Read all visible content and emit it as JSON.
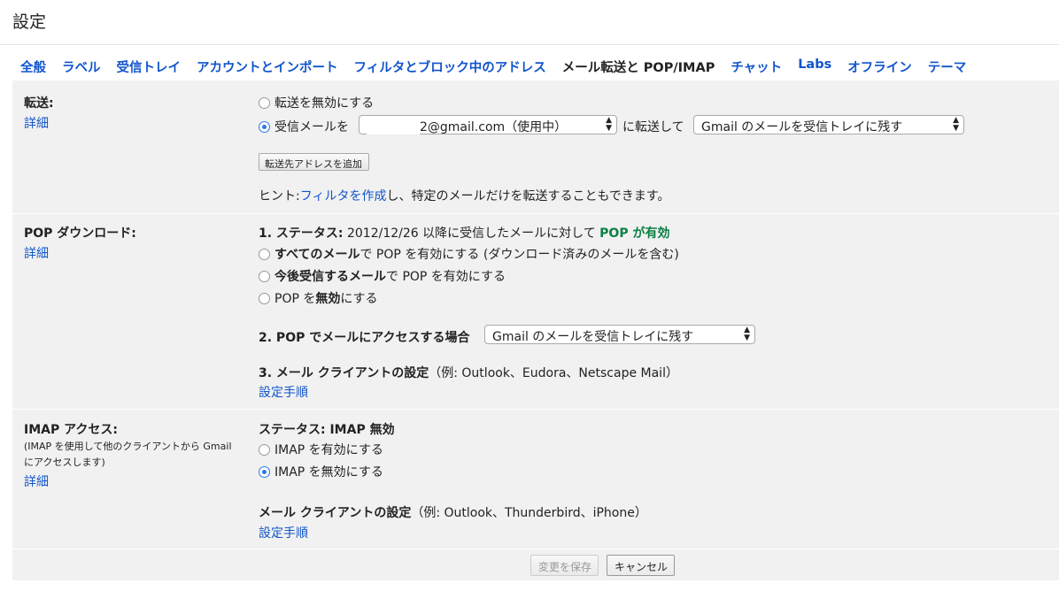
{
  "page": {
    "title": "設定"
  },
  "tabs": [
    {
      "label": "全般"
    },
    {
      "label": "ラベル"
    },
    {
      "label": "受信トレイ"
    },
    {
      "label": "アカウントとインポート"
    },
    {
      "label": "フィルタとブロック中のアドレス"
    },
    {
      "label": "メール転送と POP/IMAP",
      "active": true
    },
    {
      "label": "チャット"
    },
    {
      "label": "Labs"
    },
    {
      "label": "オフライン"
    },
    {
      "label": "テーマ"
    }
  ],
  "forwarding": {
    "label": "転送:",
    "details_link": "詳細",
    "opt_disable": "転送を無効にする",
    "opt_forward_prefix": "受信メールを",
    "address_value": "2@gmail.com（使用中）",
    "forward_mid": "に転送して",
    "keep_value": "Gmail のメールを受信トレイに残す",
    "add_button": "転送先アドレスを追加",
    "hint_prefix": "ヒント: ",
    "hint_link": "フィルタを作成",
    "hint_suffix": "し、特定のメールだけを転送することもできます。"
  },
  "pop": {
    "label": "POP ダウンロード:",
    "details_link": "詳細",
    "status_heading": "1. ステータス:",
    "status_text": " 2012/12/26 以降に受信したメールに対して ",
    "status_value": "POP が有効",
    "opt_all_bold": "すべてのメール",
    "opt_all_rest": "で POP を有効にする (ダウンロード済みのメールを含む)",
    "opt_future_bold": "今後受信するメール",
    "opt_future_rest": "で POP を有効にする",
    "opt_disable_prefix": "POP を",
    "opt_disable_bold": "無効",
    "opt_disable_suffix": "にする",
    "access_heading": "2. POP でメールにアクセスする場合",
    "access_value": "Gmail のメールを受信トレイに残す",
    "client_heading": "3. メール クライアントの設定",
    "client_examples": "（例: Outlook、Eudora、Netscape Mail）",
    "setup_link": "設定手順"
  },
  "imap": {
    "label": "IMAP アクセス:",
    "note": "(IMAP を使用して他のクライアントから Gmail にアクセスします)",
    "details_link": "詳細",
    "status": "ステータス: IMAP 無効",
    "opt_enable": "IMAP を有効にする",
    "opt_disable": "IMAP を無効にする",
    "client_heading": "メール クライアントの設定",
    "client_examples": "（例: Outlook、Thunderbird、iPhone）",
    "setup_link": "設定手順"
  },
  "footer": {
    "save_label": "変更を保存",
    "cancel_label": "キャンセル"
  },
  "colors": {
    "link": "#1155cc",
    "status_green": "#0b8043",
    "radio_selected": "#2b78e4",
    "panel_bg": "#f1f1f1"
  }
}
